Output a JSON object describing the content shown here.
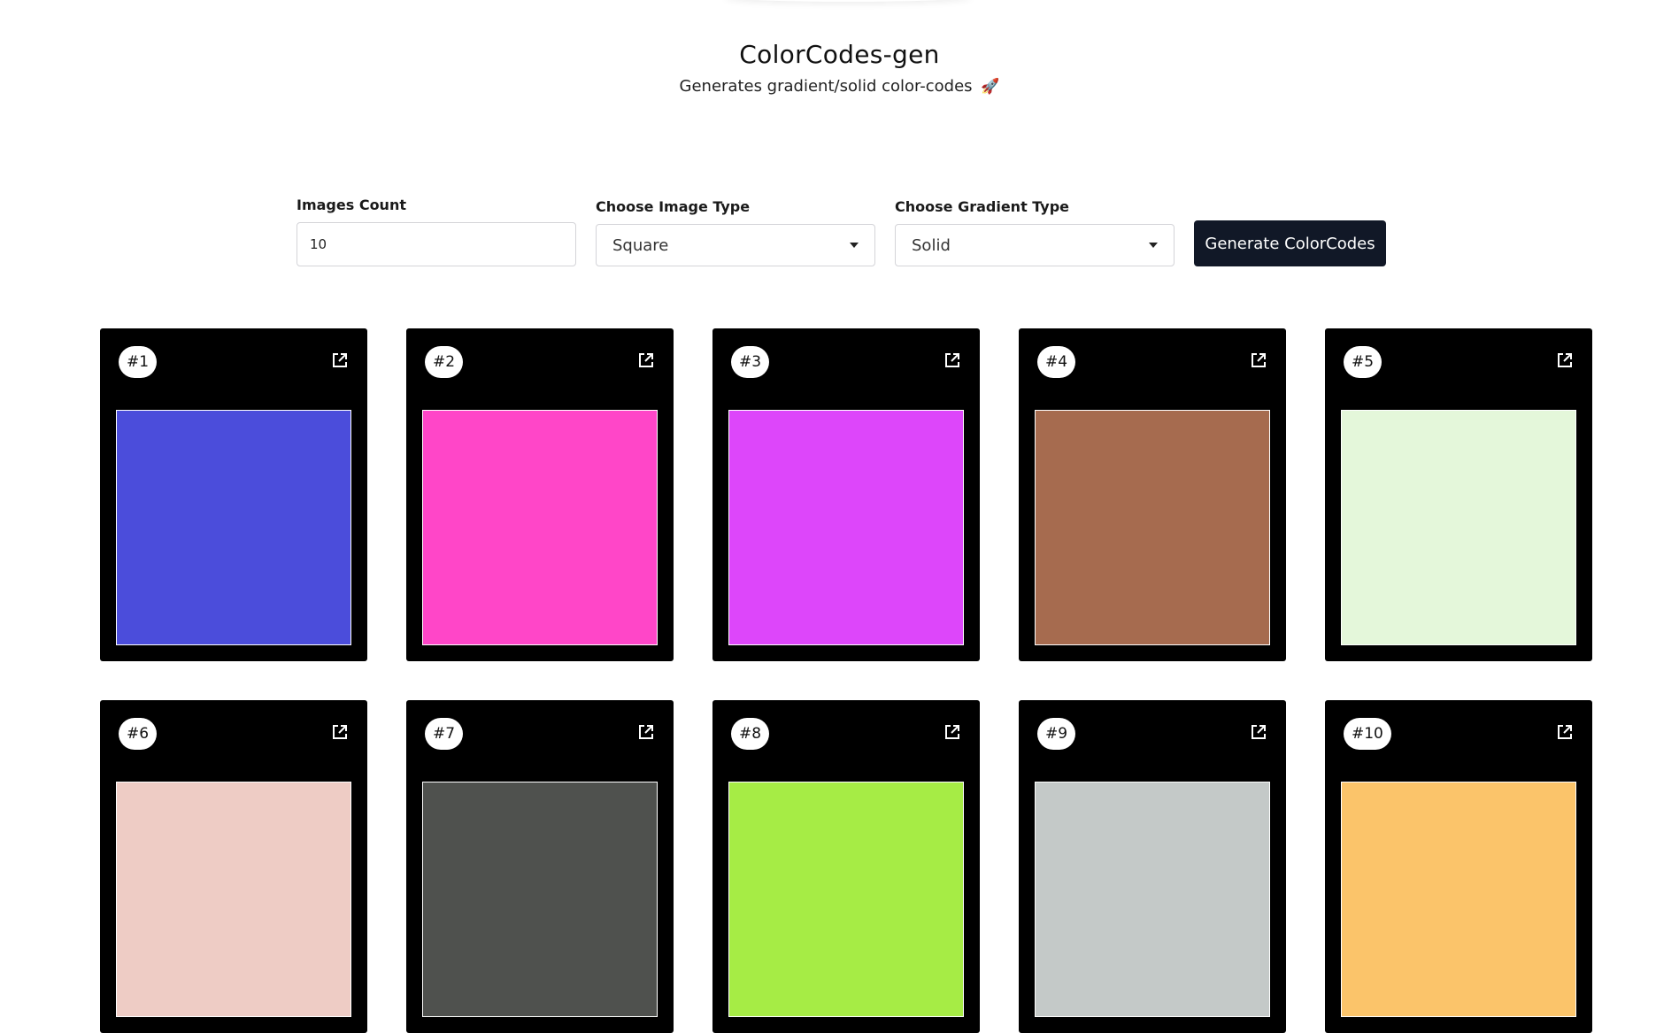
{
  "header": {
    "title": "ColorCodes-gen",
    "subtitle": "Generates gradient/solid color-codes",
    "subtitle_icon": "rocket-icon"
  },
  "controls": {
    "images_count": {
      "label": "Images Count",
      "value": "10"
    },
    "image_type": {
      "label": "Choose Image Type",
      "selected": "Square"
    },
    "gradient_type": {
      "label": "Choose Gradient Type",
      "selected": "Solid"
    },
    "generate_button_label": "Generate ColorCodes"
  },
  "cards": [
    {
      "badge": "#1",
      "color": "#4b4ddb",
      "icon": "open-external-icon"
    },
    {
      "badge": "#2",
      "color": "#ff46c8",
      "icon": "open-external-icon"
    },
    {
      "badge": "#3",
      "color": "#dd46fa",
      "icon": "open-external-icon"
    },
    {
      "badge": "#4",
      "color": "#a66b4f",
      "icon": "open-external-icon"
    },
    {
      "badge": "#5",
      "color": "#e4f7da",
      "icon": "open-external-icon"
    },
    {
      "badge": "#6",
      "color": "#eeccc5",
      "icon": "open-external-icon"
    },
    {
      "badge": "#7",
      "color": "#4f514e",
      "icon": "open-external-icon"
    },
    {
      "badge": "#8",
      "color": "#a6ec45",
      "icon": "open-external-icon"
    },
    {
      "badge": "#9",
      "color": "#c4c9c8",
      "icon": "open-external-icon"
    },
    {
      "badge": "#10",
      "color": "#fbc46a",
      "icon": "open-external-icon"
    }
  ]
}
